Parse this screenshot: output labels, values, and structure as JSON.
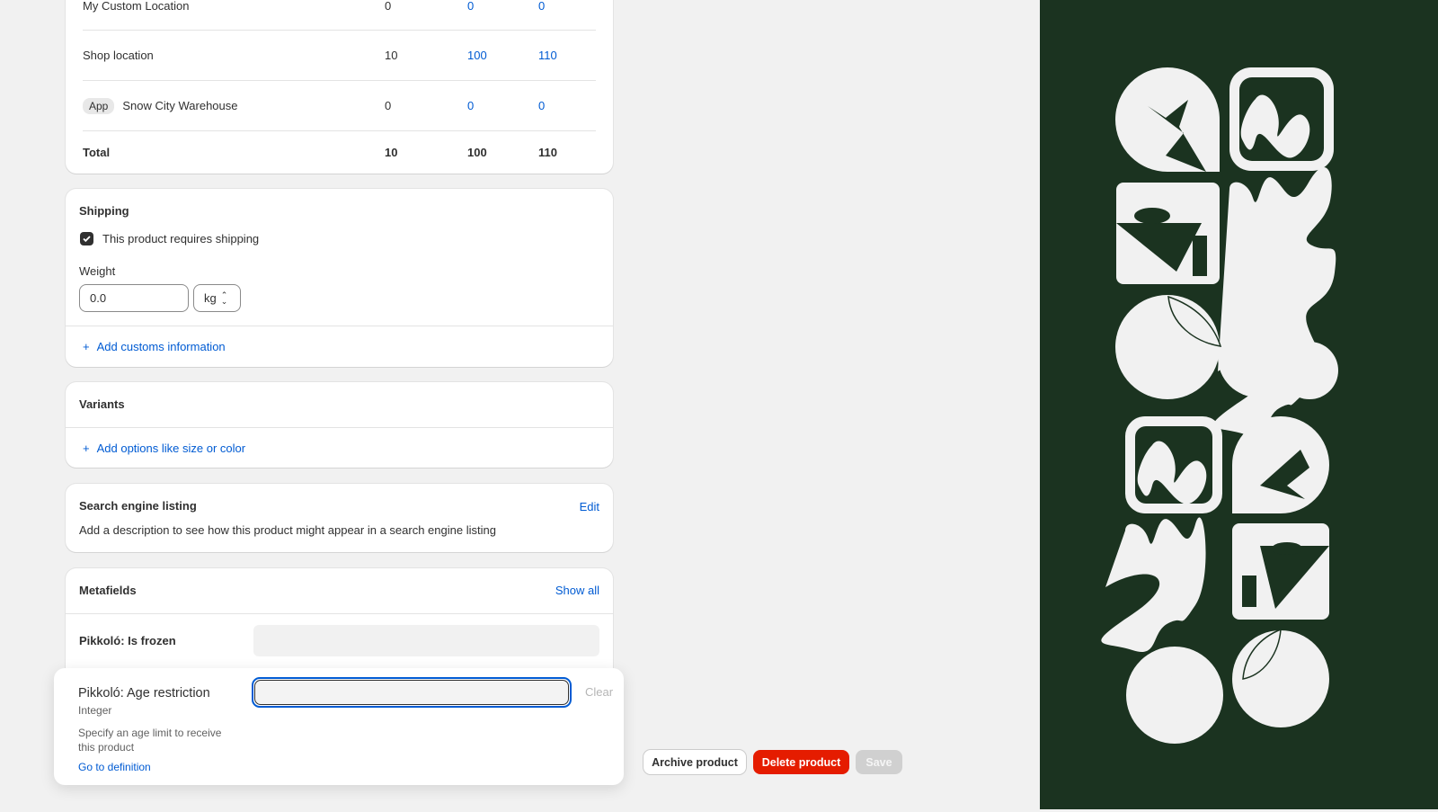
{
  "inventory": {
    "rows": [
      {
        "location": "My Custom Location",
        "badge": null,
        "unavailable": "0",
        "committed": "0",
        "available": "0"
      },
      {
        "location": "Shop location",
        "badge": null,
        "unavailable": "10",
        "committed": "100",
        "available": "110"
      },
      {
        "location": "Snow City Warehouse",
        "badge": "App",
        "unavailable": "0",
        "committed": "0",
        "available": "0"
      }
    ],
    "total": {
      "label": "Total",
      "unavailable": "10",
      "committed": "100",
      "available": "110"
    }
  },
  "shipping": {
    "title": "Shipping",
    "requires_shipping_label": "This product requires shipping",
    "requires_shipping": true,
    "weight_label": "Weight",
    "weight_value": "0.0",
    "unit": "kg",
    "customs_link": "Add customs information"
  },
  "variants": {
    "title": "Variants",
    "add_link": "Add options like size or color"
  },
  "seo": {
    "title": "Search engine listing",
    "edit": "Edit",
    "description": "Add a description to see how this product might appear in a search engine listing"
  },
  "metafields": {
    "title": "Metafields",
    "show_all": "Show all",
    "items": [
      {
        "label": "Pikkoló: Is frozen",
        "value": ""
      }
    ]
  },
  "popover": {
    "label": "Pikkoló: Age restriction",
    "type": "Integer",
    "description": "Specify an age limit to receive this product",
    "link": "Go to definition",
    "value": "",
    "clear": "Clear"
  },
  "actions": {
    "archive": "Archive product",
    "delete": "Delete product",
    "save": "Save"
  },
  "colors": {
    "accent": "#005bd3",
    "danger": "#e51c00",
    "art_bg": "#1b3320",
    "art_fg": "#f1f1f1"
  }
}
